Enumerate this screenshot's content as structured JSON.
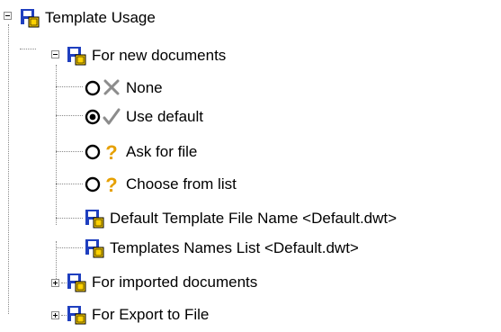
{
  "tree": {
    "root": {
      "label": "Template Usage",
      "expanded": true,
      "icon": "settings-sheet-icon"
    },
    "for_new_documents": {
      "label": "For new documents",
      "expanded": true,
      "icon": "settings-sheet-icon"
    },
    "options": [
      {
        "label": "None",
        "selected": false,
        "mark_icon": "cross-icon"
      },
      {
        "label": "Use default",
        "selected": true,
        "mark_icon": "check-icon"
      },
      {
        "label": "Ask for file",
        "selected": false,
        "mark_icon": "question-icon"
      },
      {
        "label": "Choose from list",
        "selected": false,
        "mark_icon": "question-icon"
      }
    ],
    "settings": [
      {
        "label": "Default Template File Name <Default.dwt>",
        "icon": "settings-sheet-icon"
      },
      {
        "label": "Templates Names List <Default.dwt>",
        "icon": "settings-sheet-icon"
      }
    ],
    "for_imported_documents": {
      "label": "For imported documents",
      "expanded": false,
      "icon": "settings-sheet-icon"
    },
    "for_export_to_file": {
      "label": "For Export to File",
      "expanded": false,
      "icon": "settings-sheet-icon"
    }
  },
  "colors": {
    "sheet_blue": "#1f3fbf",
    "sheet_yellow": "#ffd200",
    "mark_gray": "#8c8c8c",
    "mark_orange": "#e6a000",
    "tree_line": "#8a8a8a"
  }
}
